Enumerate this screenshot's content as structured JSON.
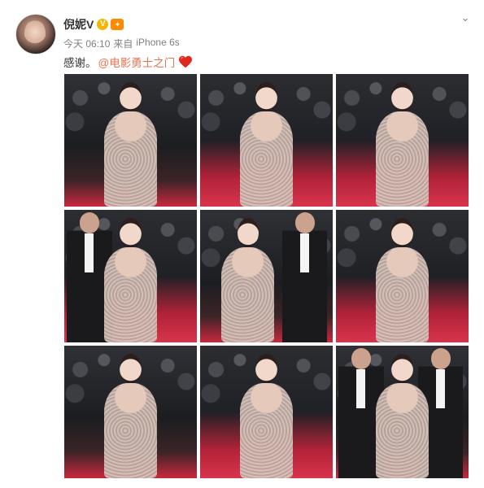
{
  "post": {
    "username": "倪妮V",
    "verified_glyph": "V",
    "member_glyph": "✦",
    "time": "今天 06:10",
    "source_prefix": "来自",
    "source": "iPhone 6s",
    "text": "感谢。",
    "mention": "@电影勇士之门",
    "chevron_glyph": "⌄"
  },
  "icons": {
    "verified": "verified-badge-icon",
    "member": "vip-crown-icon",
    "heart": "red-heart-emoji-icon",
    "chevron": "chevron-down-icon"
  },
  "colors": {
    "username": "#333333",
    "meta": "#808080",
    "mention": "#eb7350",
    "verified": "#f7b500",
    "heart": "#e0281e",
    "red_carpet": "#c8283e"
  },
  "photos": [
    {
      "index": 1
    },
    {
      "index": 2
    },
    {
      "index": 3
    },
    {
      "index": 4
    },
    {
      "index": 5
    },
    {
      "index": 6
    },
    {
      "index": 7
    },
    {
      "index": 8
    },
    {
      "index": 9
    }
  ]
}
